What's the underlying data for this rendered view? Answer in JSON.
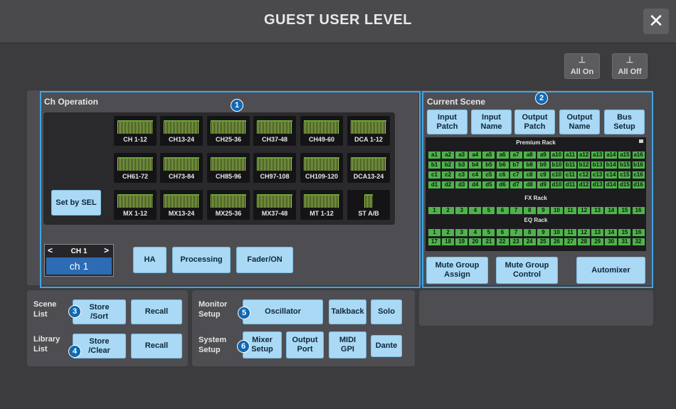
{
  "title": "GUEST USER LEVEL",
  "close_label": "✕",
  "top_buttons": {
    "all_on": "All On",
    "all_off": "All Off"
  },
  "ch_operation": {
    "title": "Ch Operation",
    "set_by_sel": "Set by SEL",
    "faders": [
      "CH 1-12",
      "CH13-24",
      "CH25-36",
      "CH37-48",
      "CH49-60",
      "DCA 1-12",
      "CH61-72",
      "CH73-84",
      "CH85-96",
      "CH97-108",
      "CH109-120",
      "DCA13-24",
      "MX 1-12",
      "MX13-24",
      "MX25-36",
      "MX37-48",
      "MT 1-12",
      "ST A/B"
    ],
    "channel_selector": {
      "top_label": "CH 1",
      "name": "ch 1",
      "prev": "<",
      "next": ">"
    },
    "buttons": {
      "ha": "HA",
      "processing": "Processing",
      "fader_on": "Fader/ON"
    }
  },
  "current_scene": {
    "title": "Current Scene",
    "buttons": [
      {
        "l1": "Input",
        "l2": "Patch"
      },
      {
        "l1": "Input",
        "l2": "Name"
      },
      {
        "l1": "Output",
        "l2": "Patch"
      },
      {
        "l1": "Output",
        "l2": "Name"
      },
      {
        "l1": "Bus",
        "l2": "Setup"
      }
    ],
    "premium_rack": {
      "title": "Premium Rack",
      "rows": [
        [
          "a1",
          "a2",
          "a3",
          "a4",
          "a5",
          "a6",
          "a7",
          "a8",
          "a9",
          "a10",
          "a11",
          "a12",
          "a13",
          "a14",
          "a15",
          "a16"
        ],
        [
          "b1",
          "b2",
          "b3",
          "b4",
          "b5",
          "b6",
          "b7",
          "b8",
          "b9",
          "b10",
          "b11",
          "b12",
          "b13",
          "b14",
          "b15",
          "b16"
        ],
        [
          "c1",
          "c2",
          "c3",
          "c4",
          "c5",
          "c6",
          "c7",
          "c8",
          "c9",
          "c10",
          "c11",
          "c12",
          "c13",
          "c14",
          "c15",
          "c16"
        ],
        [
          "d1",
          "d2",
          "d3",
          "d4",
          "d5",
          "d6",
          "d7",
          "d8",
          "d9",
          "d10",
          "d11",
          "d12",
          "d13",
          "d14",
          "d15",
          "d16"
        ]
      ]
    },
    "fx_rack": {
      "title": "FX Rack",
      "cells": [
        "1",
        "2",
        "3",
        "4",
        "5",
        "6",
        "7",
        "8",
        "9",
        "10",
        "11",
        "12",
        "13",
        "14",
        "15",
        "16"
      ]
    },
    "eq_rack": {
      "title": "EQ Rack",
      "rows": [
        [
          "1",
          "2",
          "3",
          "4",
          "5",
          "6",
          "7",
          "8",
          "9",
          "10",
          "11",
          "12",
          "13",
          "14",
          "15",
          "16"
        ],
        [
          "17",
          "18",
          "19",
          "20",
          "21",
          "22",
          "23",
          "24",
          "25",
          "26",
          "27",
          "28",
          "29",
          "30",
          "31",
          "32"
        ]
      ]
    },
    "bottom_buttons": {
      "mute_group_assign": "Mute Group\nAssign",
      "mute_group_control": "Mute Group\nControl",
      "automixer": "Automixer"
    }
  },
  "scene_list": {
    "label": "Scene\nList",
    "store_sort": "Store\n/Sort",
    "recall": "Recall"
  },
  "library_list": {
    "label": "Library\nList",
    "store_clear": "Store\n/Clear",
    "recall": "Recall"
  },
  "monitor_setup": {
    "label": "Monitor\nSetup",
    "oscillator": "Oscillator",
    "talkback": "Talkback",
    "solo": "Solo"
  },
  "system_setup": {
    "label": "System\nSetup",
    "mixer_setup": "Mixer\nSetup",
    "output_port": "Output\nPort",
    "midi_gpi": "MIDI\nGPI",
    "dante": "Dante"
  },
  "badges": [
    "1",
    "2",
    "3",
    "4",
    "5",
    "6"
  ],
  "colors": {
    "button": "#a9d9f5",
    "highlight": "#3fa4e8",
    "rack_cell": "#4fb34c",
    "badge": "#1268b3"
  }
}
